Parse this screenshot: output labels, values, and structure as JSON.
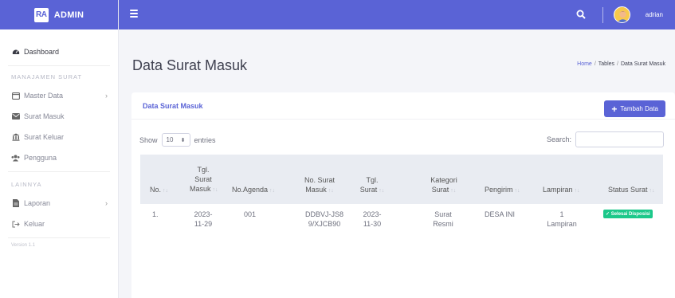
{
  "brand": {
    "logo": "RA",
    "name": "ADMIN"
  },
  "sidebar": {
    "dashboard": "Dashboard",
    "heading_manage": "MANAJAMEN SURAT",
    "items_manage": [
      {
        "label": "Master Data",
        "icon": "window-icon",
        "has_chevron": true
      },
      {
        "label": "Surat Masuk",
        "icon": "envelope-icon"
      },
      {
        "label": "Surat Keluar",
        "icon": "building-icon"
      },
      {
        "label": "Pengguna",
        "icon": "users-icon"
      }
    ],
    "heading_other": "LAINNYA",
    "items_other": [
      {
        "label": "Laporan",
        "icon": "file-icon",
        "has_chevron": true
      },
      {
        "label": "Keluar",
        "icon": "logout-icon"
      }
    ],
    "version": "Version 1.1"
  },
  "topbar": {
    "user_name": "adrian"
  },
  "page": {
    "title": "Data Surat Masuk",
    "breadcrumb": [
      "Home",
      "Tables",
      "Data Surat Masuk"
    ]
  },
  "card": {
    "title": "Data Surat Masuk",
    "add_button": "Tambah Data",
    "show_label": "Show",
    "entries_value": "10",
    "entries_label": "entries",
    "search_label": "Search:",
    "columns": [
      "No.",
      "Tgl. Surat Masuk",
      "No.Agenda",
      "No. Surat Masuk",
      "Tgl. Surat",
      "Kategori Surat",
      "Pengirim",
      "Lampiran",
      "Status Surat"
    ],
    "rows": [
      {
        "no": "1.",
        "tgl_masuk": "2023-11-29",
        "agenda": "001",
        "no_surat": "DDBVJ-JS89/XJCB90",
        "tgl_surat": "2023-11-30",
        "kategori": "Surat Resmi",
        "pengirim": "DESA INI",
        "lampiran": "1 Lampiran",
        "status": "Selesai Disposisi"
      }
    ]
  },
  "colors": {
    "primary": "#5a63d6",
    "success": "#1cc88a"
  }
}
